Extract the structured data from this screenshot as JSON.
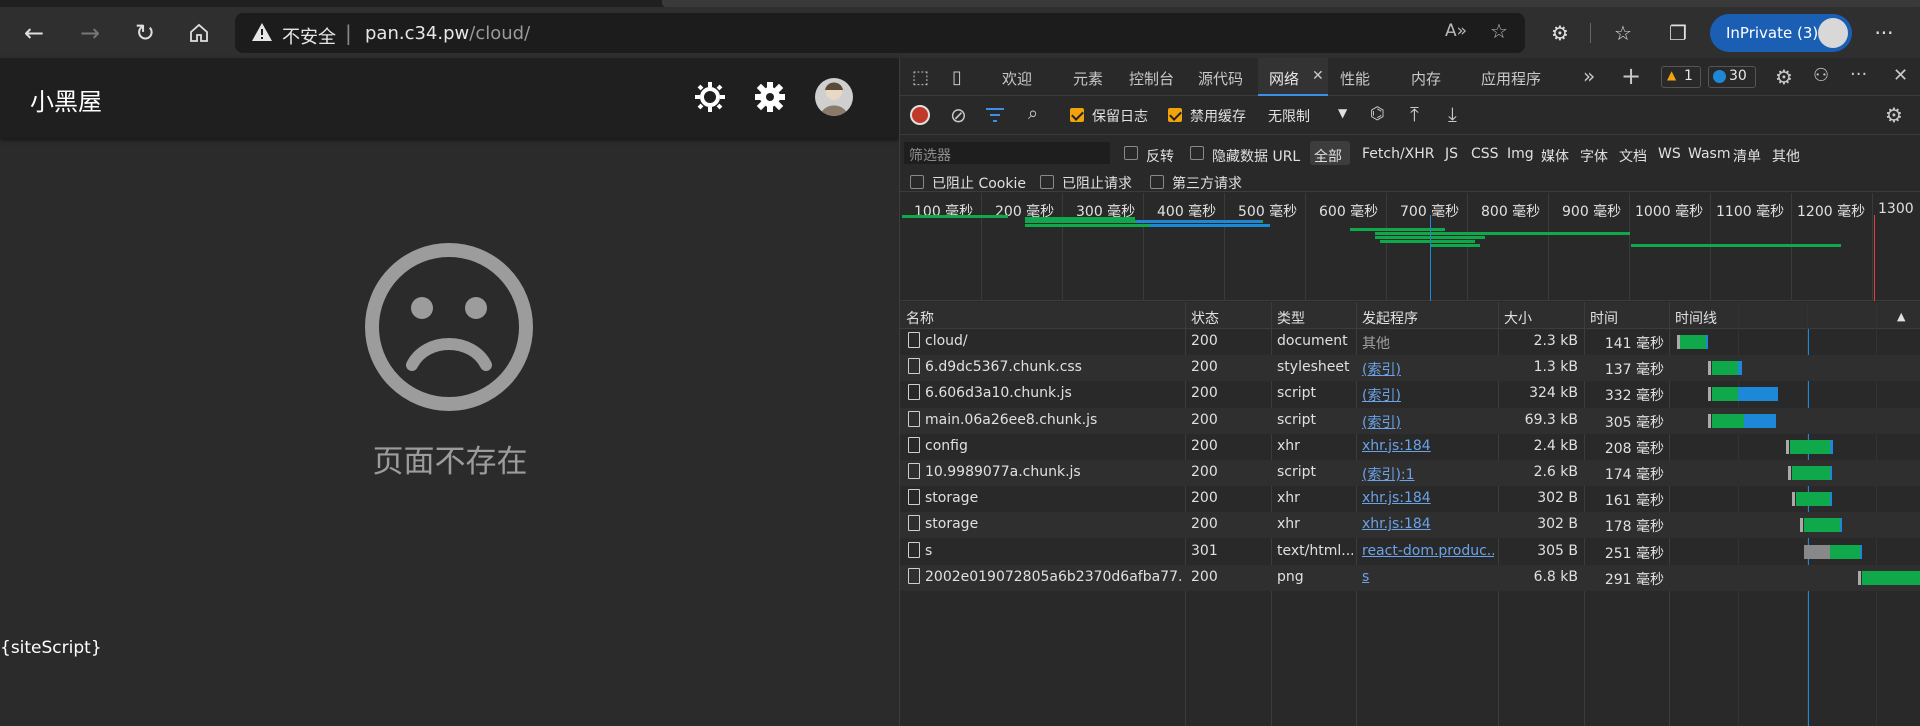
{
  "browser": {
    "insecure_label": "不安全",
    "separator": "|",
    "url_host": "pan.c34.pw",
    "url_path": "/cloud/",
    "inprivate_label": "InPrivate (3)"
  },
  "page": {
    "app_title": "小黑屋",
    "error_text": "页面不存在",
    "site_script": "{siteScript}"
  },
  "devtools": {
    "tabs": [
      "欢迎",
      "元素",
      "控制台",
      "源代码",
      "网络",
      "性能",
      "内存",
      "应用程序"
    ],
    "active_tab": "网络",
    "warning_count": "1",
    "message_count": "30",
    "preserve_log": "保留日志",
    "disable_cache": "禁用缓存",
    "throttle": "无限制",
    "filter_placeholder": "筛选器",
    "invert": "反转",
    "hide_data_url": "隐藏数据 URL",
    "all": "全部",
    "types": [
      "Fetch/XHR",
      "JS",
      "CSS",
      "Img",
      "媒体",
      "字体",
      "文档",
      "WS",
      "Wasm",
      "清单",
      "其他"
    ],
    "blocked_cookie": "已阻止 Cookie",
    "blocked_requests": "已阻止请求",
    "third_party": "第三方请求",
    "ticks": [
      "100 毫秒",
      "200 毫秒",
      "300 毫秒",
      "400 毫秒",
      "500 毫秒",
      "600 毫秒",
      "700 毫秒",
      "800 毫秒",
      "900 毫秒",
      "1000 毫秒",
      "1100 毫秒",
      "1200 毫秒",
      "1300"
    ],
    "columns": [
      "名称",
      "状态",
      "类型",
      "发起程序",
      "大小",
      "时间",
      "时间线"
    ],
    "rows": [
      {
        "name": "cloud/",
        "status": "200",
        "type": "document",
        "initiator": "其他",
        "initiator_link": false,
        "size": "2.3 kB",
        "time": "141 毫秒"
      },
      {
        "name": "6.d9dc5367.chunk.css",
        "status": "200",
        "type": "stylesheet",
        "initiator": "(索引)",
        "initiator_link": true,
        "size": "1.3 kB",
        "time": "137 毫秒"
      },
      {
        "name": "6.606d3a10.chunk.js",
        "status": "200",
        "type": "script",
        "initiator": "(索引)",
        "initiator_link": true,
        "size": "324 kB",
        "time": "332 毫秒"
      },
      {
        "name": "main.06a26ee8.chunk.js",
        "status": "200",
        "type": "script",
        "initiator": "(索引)",
        "initiator_link": true,
        "size": "69.3 kB",
        "time": "305 毫秒"
      },
      {
        "name": "config",
        "status": "200",
        "type": "xhr",
        "initiator": "xhr.js:184",
        "initiator_link": true,
        "size": "2.4 kB",
        "time": "208 毫秒"
      },
      {
        "name": "10.9989077a.chunk.js",
        "status": "200",
        "type": "script",
        "initiator": "(索引):1",
        "initiator_link": true,
        "size": "2.6 kB",
        "time": "174 毫秒"
      },
      {
        "name": "storage",
        "status": "200",
        "type": "xhr",
        "initiator": "xhr.js:184",
        "initiator_link": true,
        "size": "302 B",
        "time": "161 毫秒"
      },
      {
        "name": "storage",
        "status": "200",
        "type": "xhr",
        "initiator": "xhr.js:184",
        "initiator_link": true,
        "size": "302 B",
        "time": "178 毫秒"
      },
      {
        "name": "s",
        "status": "301",
        "type": "text/html...",
        "initiator": "react-dom.produc...",
        "initiator_link": true,
        "size": "305 B",
        "time": "251 毫秒"
      },
      {
        "name": "2002e019072805a6b2370d6afba77...",
        "status": "200",
        "type": "png",
        "initiator": "s",
        "initiator_link": true,
        "size": "6.8 kB",
        "time": "291 毫秒"
      }
    ]
  },
  "colors": {
    "accent": "#1a5fb4",
    "bar_green": "#0fa84a",
    "bar_blue": "#1e88d8",
    "checkbox": "#f0a30a"
  }
}
